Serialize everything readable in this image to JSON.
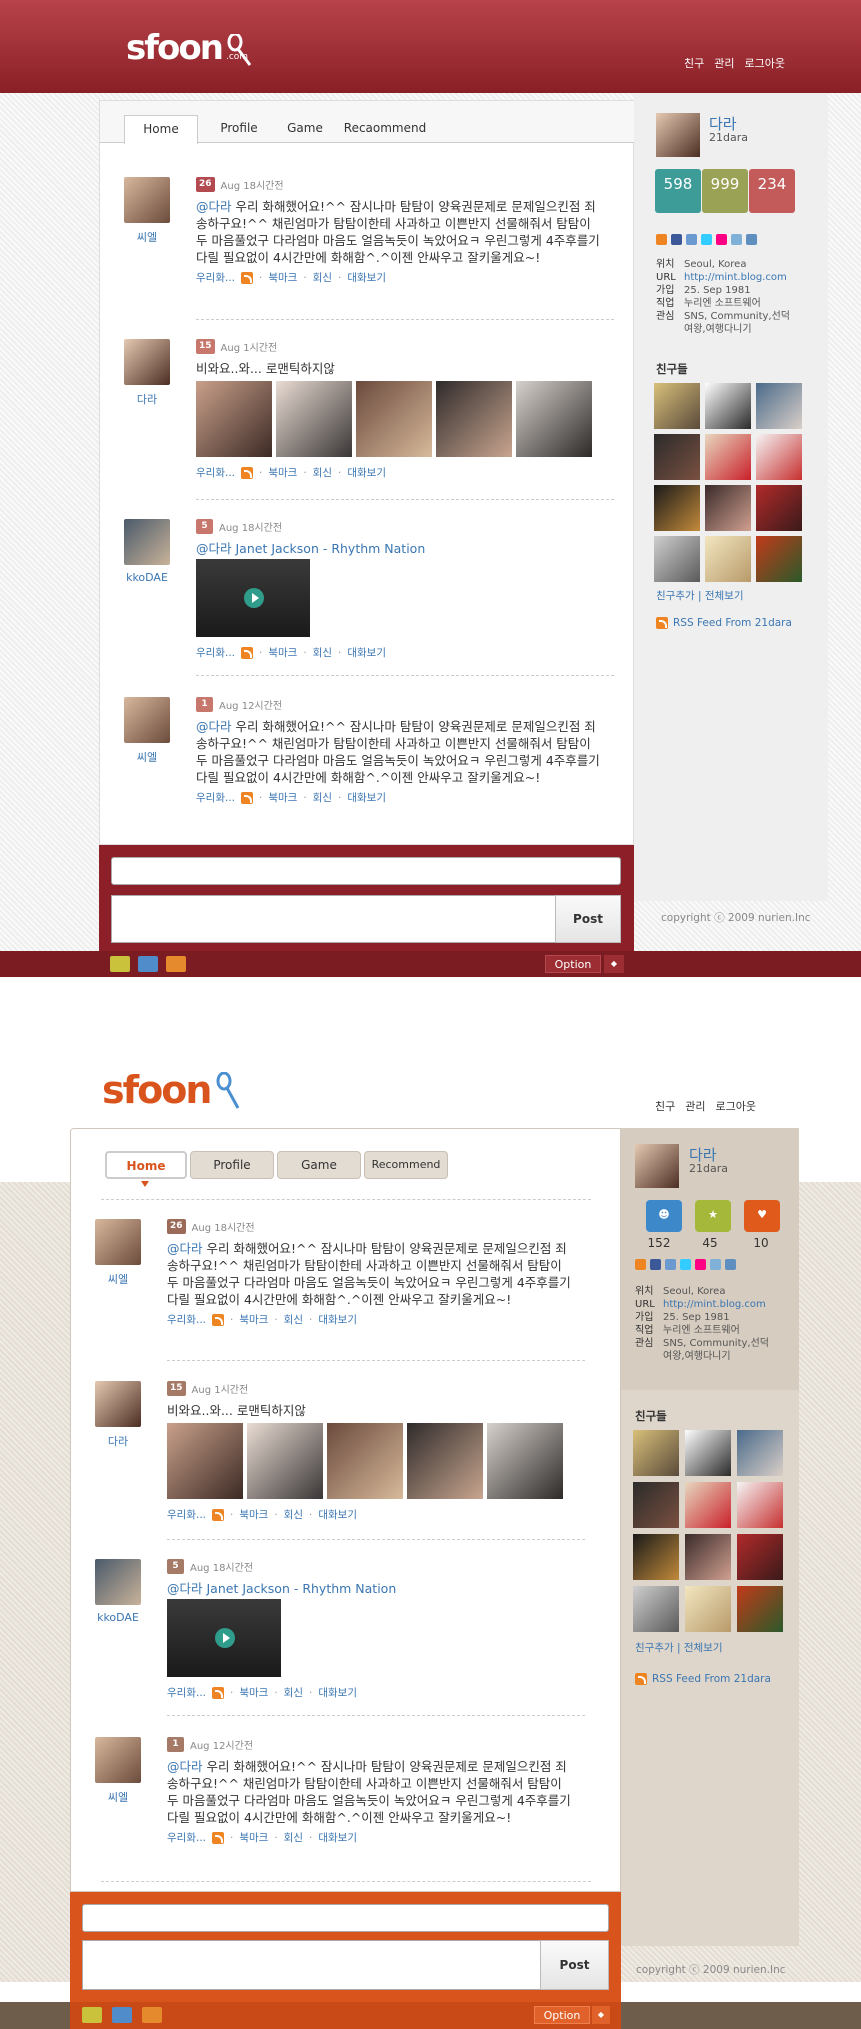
{
  "mockups": [
    {
      "logo": "sfoon",
      "logo_suffix": ".com",
      "topnav": [
        "친구",
        "관리",
        "로그아웃"
      ],
      "tabs": [
        "Home",
        "Profile",
        "Game",
        "Recaommend"
      ],
      "active_tab": "Home"
    },
    {
      "logo": "sfoon",
      "topnav": [
        "친구",
        "관리",
        "로그아웃"
      ],
      "tabs": [
        "Home",
        "Profile",
        "Game",
        "Recommend"
      ],
      "active_tab": "Home"
    }
  ],
  "posts": [
    {
      "user": "씨엘",
      "count": "26",
      "time": "Aug 18시간전",
      "mention": "@다라",
      "text": " 우리 화해했어요!^^ 잠시나마 탐탐이 양육권문제로 문제일으킨점 죄송하구요!^^ 채린엄마가 탐탐이한테 사과하고 이쁜반지 선물해줘서 탐탐이두 마음풀었구 다라엄마 마음도 얼음녹듯이 녹았어요ㅋ 우린그렇게 4주후를기다릴 필요없이 4시간만에 화해함^.^이젠 안싸우고 잘키울게요~!"
    },
    {
      "user": "다라",
      "count": "15",
      "time": "Aug 1시간전",
      "mention": "",
      "text": "비와요..와... 로맨틱하지않"
    },
    {
      "user": "kkoDAE",
      "count": "5",
      "time": "Aug 18시간전",
      "mention": "@다라",
      "text": " Janet Jackson - Rhythm Nation"
    },
    {
      "user": "씨엘",
      "count": "1",
      "time": "Aug 12시간전",
      "mention": "@다라",
      "text": " 우리 화해했어요!^^ 잠시나마 탐탐이 양육권문제로 문제일으킨점 죄송하구요!^^ 채린엄마가 탐탐이한테 사과하고 이쁜반지 선물해줘서 탐탐이두 마음풀었구 다라엄마 마음도 얼음녹듯이 녹았어요ㅋ 우린그렇게 4주후를기다릴 필요없이 4시간만에 화해함^.^이젠 안싸우고 잘키울게요~!"
    }
  ],
  "post_actions": {
    "share": "우리화...",
    "bookmark": "북마크",
    "reply": "회신",
    "conversation": "대화보기"
  },
  "profile": {
    "name": "다라",
    "id": "21dara",
    "stats1": [
      "598",
      "999",
      "234"
    ],
    "stats2": [
      "152",
      "45",
      "10"
    ],
    "info": [
      {
        "k": "위치",
        "v": "Seoul, Korea"
      },
      {
        "k": "URL",
        "v": "http://mint.blog.com"
      },
      {
        "k": "가입",
        "v": "25. Sep 1981"
      },
      {
        "k": "직업",
        "v": "누리엔 소프트웨어"
      },
      {
        "k": "관심",
        "v": "SNS, Community,선덕"
      },
      {
        "k": "",
        "v": "여왕,여행다니기"
      }
    ]
  },
  "friends": {
    "title": "친구들",
    "links": "친구추가 | 전체보기",
    "rss": "RSS Feed From 21dara"
  },
  "composer": {
    "post_label": "Post",
    "option_label": "Option",
    "option_arrow": "◆"
  },
  "copyright": "copyright ⓒ 2009 nurien.Inc",
  "colors": {
    "theme1": "#8c1f27",
    "theme2": "#d9541c",
    "count1": [
      "#b24a4f",
      "#c7776c",
      "#c7776c",
      "#c7776c"
    ],
    "count2": [
      "#9b6a58",
      "#a57a66",
      "#a57a66",
      "#a57a66"
    ],
    "link": "#3a76b2"
  }
}
